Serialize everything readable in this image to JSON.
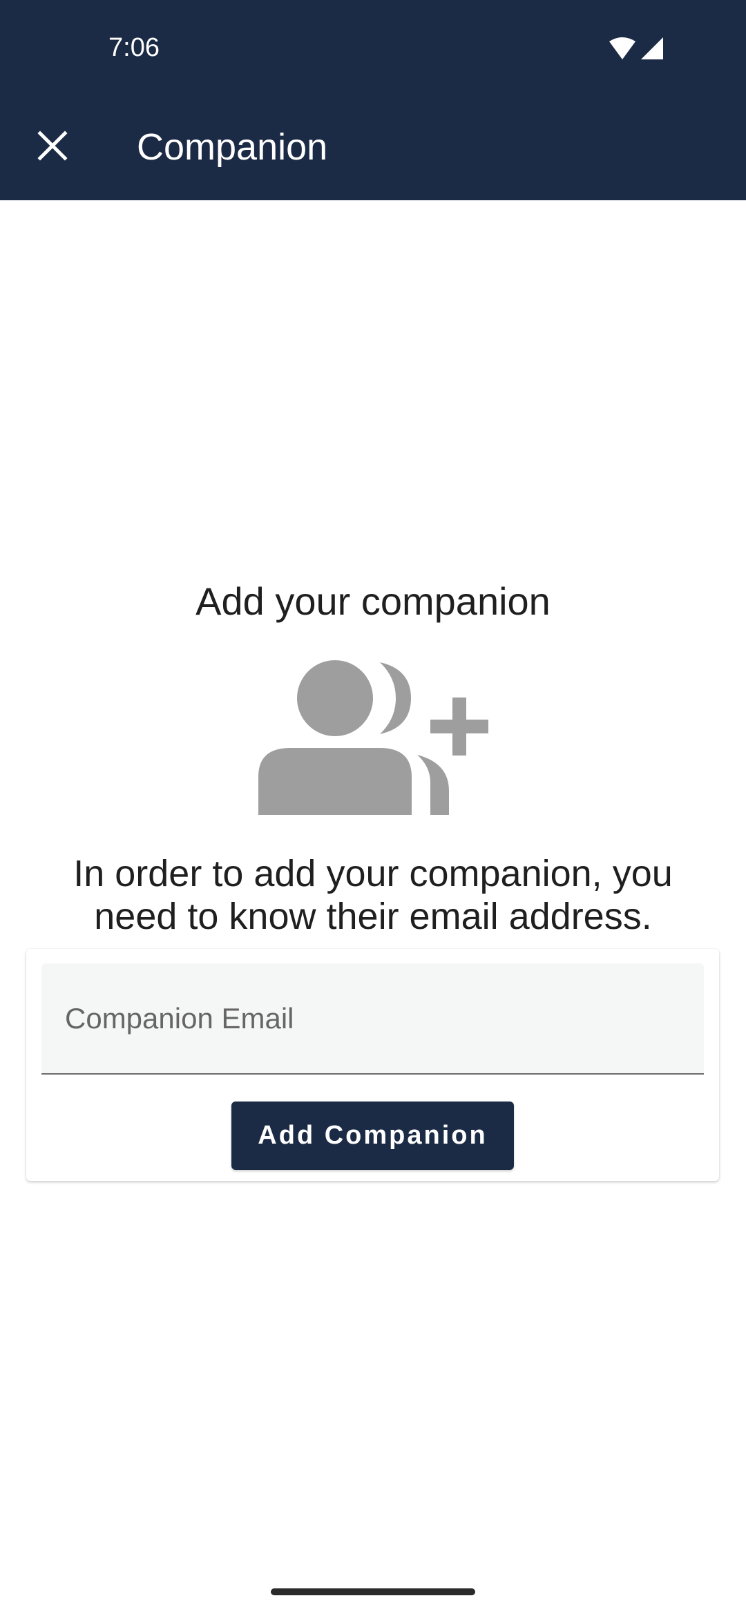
{
  "status_bar": {
    "time": "7:06",
    "wifi_icon": "wifi-icon",
    "signal_icon": "cell-signal-icon"
  },
  "app_bar": {
    "close_icon": "close-icon",
    "title": "Companion",
    "background_color": "#1c2b45"
  },
  "content": {
    "heading": "Add your companion",
    "illustration_icon": "add-group-icon",
    "description": "In order to add your companion, you need to know their email address."
  },
  "form": {
    "email_placeholder": "Companion Email",
    "email_value": "",
    "submit_label": "Add Companion"
  },
  "colors": {
    "primary": "#1c2b45",
    "icon_gray": "#9e9e9e",
    "field_background": "#f5f6f6"
  }
}
